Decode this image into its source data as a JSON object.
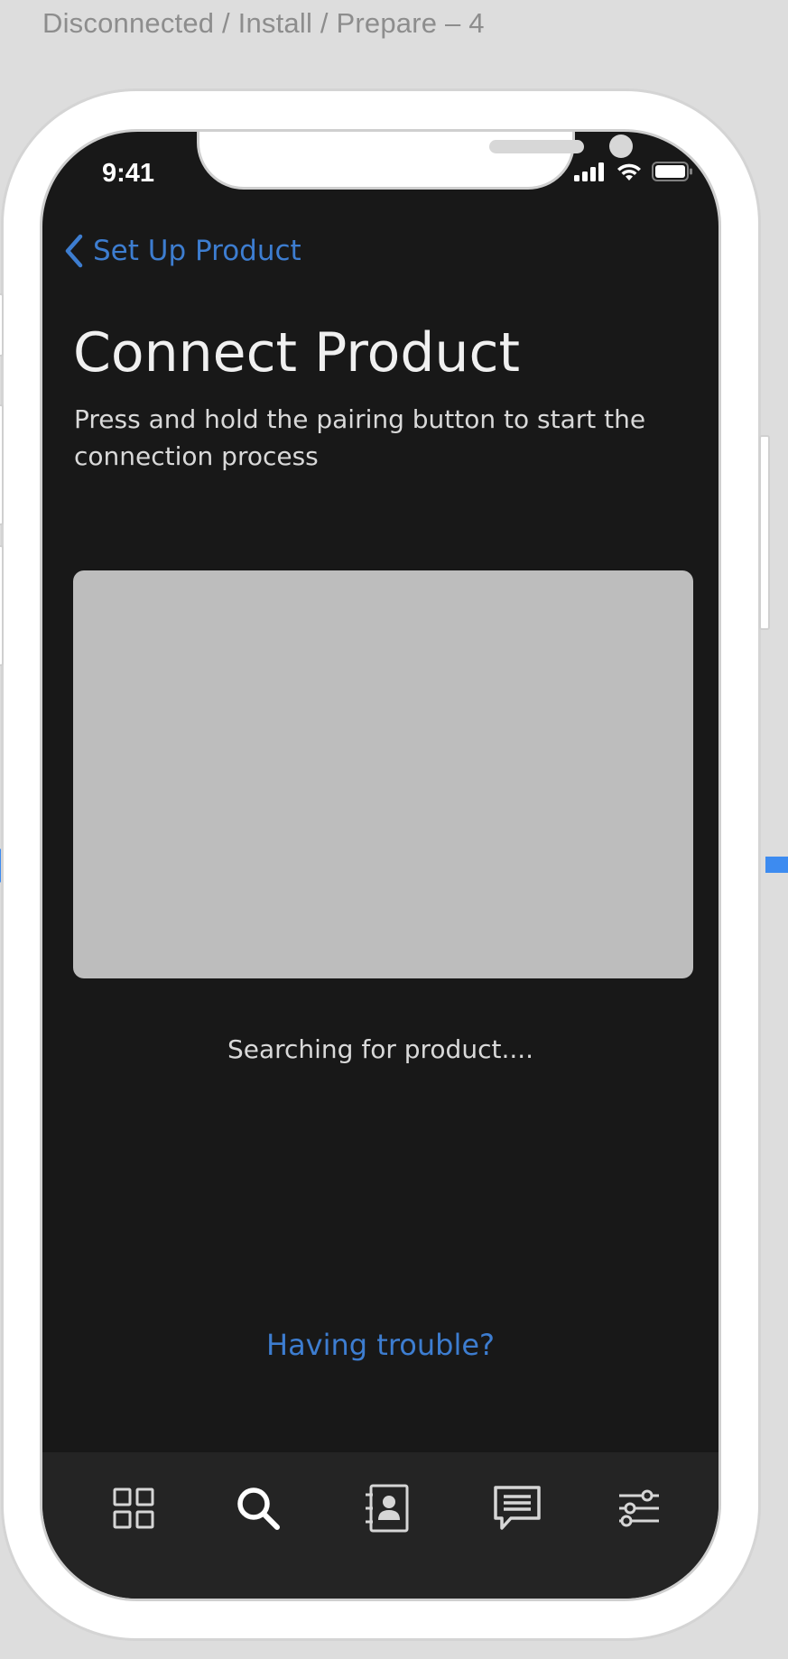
{
  "artboard": {
    "title": "Disconnected / Install / Prepare – 4"
  },
  "status_bar": {
    "time": "9:41",
    "icons": [
      "signal-icon",
      "wifi-icon",
      "battery-icon"
    ]
  },
  "navigation": {
    "back_label": "Set Up Product",
    "back_icon": "chevron-left-icon"
  },
  "content": {
    "title": "Connect Product",
    "subtitle": "Press and hold the pairing button to start the connection process",
    "status": "Searching for product....",
    "help_link": "Having trouble?"
  },
  "tab_bar": {
    "tabs": [
      {
        "icon": "grid-icon",
        "active": false
      },
      {
        "icon": "search-icon",
        "active": true
      },
      {
        "icon": "contacts-icon",
        "active": false
      },
      {
        "icon": "chat-icon",
        "active": false
      },
      {
        "icon": "settings-sliders-icon",
        "active": false
      }
    ]
  },
  "colors": {
    "background": "#dddddd",
    "screen": "#181818",
    "tab_bar": "#242424",
    "accent": "#3d7dd0",
    "placeholder": "#bdbdbd",
    "prototype_link": "#3d8bf0"
  }
}
